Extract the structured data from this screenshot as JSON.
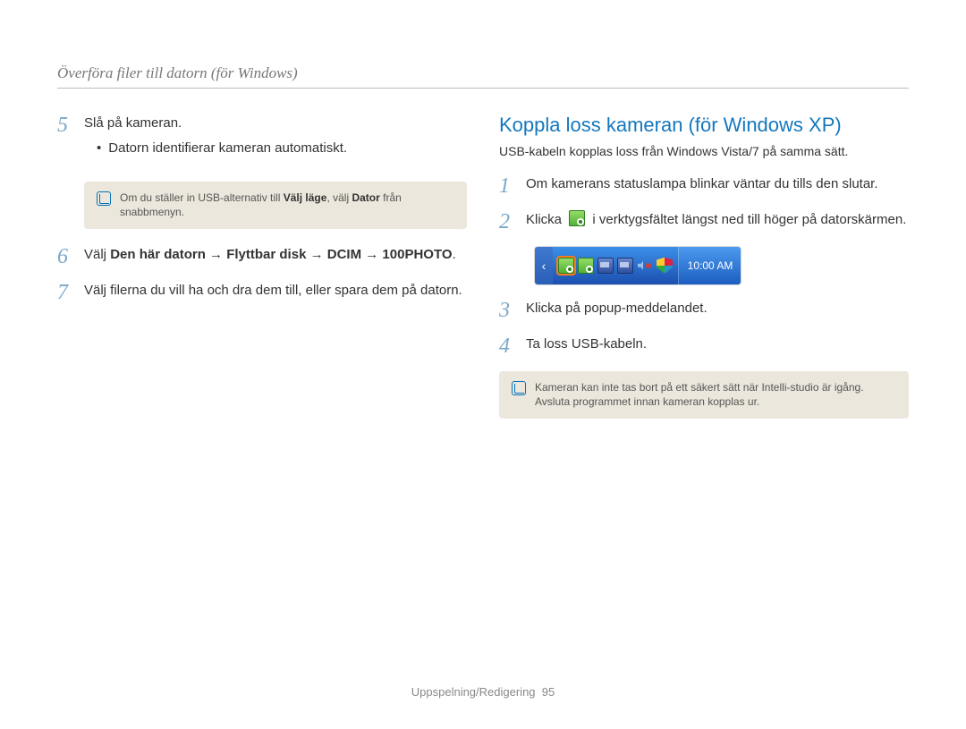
{
  "header": {
    "breadcrumb": "Överföra filer till datorn (för Windows)"
  },
  "left": {
    "step5": {
      "num": "5",
      "title": "Slå på kameran.",
      "bullet": "Datorn identifierar kameran automatiskt.",
      "note_prefix": "Om du ställer in USB-alternativ till ",
      "note_bold1": "Välj läge",
      "note_mid": ", välj ",
      "note_bold2": "Dator",
      "note_suffix": " från snabbmenyn."
    },
    "step6": {
      "num": "6",
      "pre": "Välj ",
      "b1": "Den här datorn",
      "arr": "→",
      "b2": "Flyttbar disk",
      "b3": "DCIM",
      "b4": "100PHOTO",
      "post": "."
    },
    "step7": {
      "num": "7",
      "text": "Välj filerna du vill ha och dra dem till, eller spara dem på datorn."
    }
  },
  "right": {
    "heading": "Koppla loss kameran (för Windows XP)",
    "intro": "USB-kabeln kopplas loss från Windows Vista/7 på samma sätt.",
    "step1": {
      "num": "1",
      "text": "Om kamerans statuslampa blinkar väntar du tills den slutar."
    },
    "step2": {
      "num": "2",
      "pre": "Klicka ",
      "post": " i verktygsfältet längst ned till höger på datorskärmen."
    },
    "taskbar_clock": "10:00 AM",
    "step3": {
      "num": "3",
      "text": "Klicka på popup-meddelandet."
    },
    "step4": {
      "num": "4",
      "text": "Ta loss USB-kabeln."
    },
    "note": "Kameran kan inte tas bort på ett säkert sätt när Intelli-studio är igång. Avsluta programmet innan kameran kopplas ur."
  },
  "footer": {
    "section": "Uppspelning/Redigering",
    "page": "95"
  }
}
